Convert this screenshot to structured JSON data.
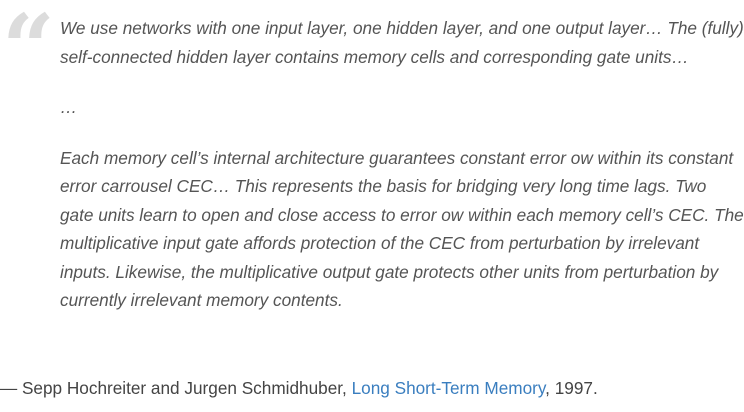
{
  "quote": {
    "mark": "“",
    "paragraph1": "We use networks with one input layer, one hidden layer, and one output layer… The (fully) self-connected hidden layer contains memory cells and corresponding gate units…",
    "ellipsis": "…",
    "paragraph2": "Each memory cell’s internal architecture guarantees constant error ow within its constant error carrousel CEC… This represents the basis for bridging very long time lags. Two gate units learn to open and close access to error ow within each memory cell’s CEC. The multiplicative input gate affords protection of the CEC from perturbation by irrelevant inputs. Likewise, the multiplicative output gate protects other units from perturbation by currently irrelevant memory contents."
  },
  "attribution": {
    "prefix": "— Sepp Hochreiter and Jurgen Schmidhuber, ",
    "link_text": "Long Short-Term Memory",
    "suffix": ", 1997.",
    "link_color": "#3a7ebf"
  }
}
